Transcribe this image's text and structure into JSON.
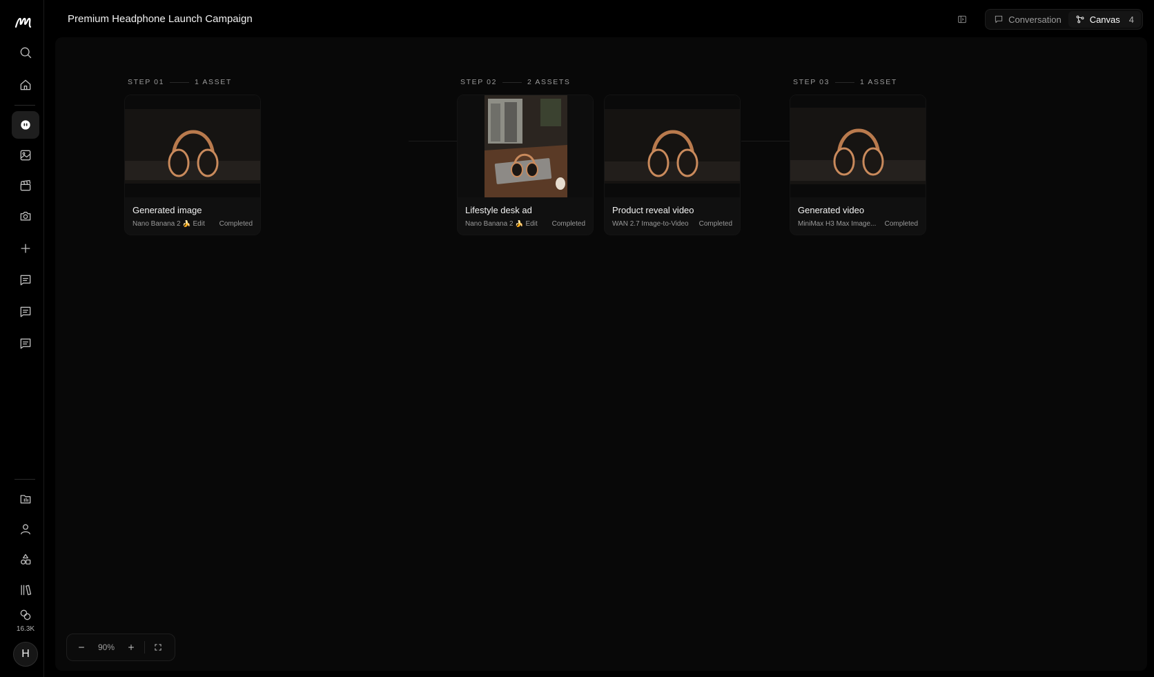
{
  "header": {
    "title": "Premium Headphone Launch Campaign",
    "tabs": [
      {
        "label": "Conversation",
        "active": false
      },
      {
        "label": "Canvas",
        "active": true,
        "count": "4"
      }
    ]
  },
  "sidebar": {
    "credits": "16.3K",
    "avatar_initial": "H"
  },
  "canvas": {
    "steps": [
      {
        "label": "STEP 01",
        "assets": "1 ASSET"
      },
      {
        "label": "STEP 02",
        "assets": "2 ASSETS"
      },
      {
        "label": "STEP 03",
        "assets": "1 ASSET"
      }
    ],
    "cards": [
      {
        "title": "Generated image",
        "model": "Nano Banana 2 🍌 Edit",
        "status": "Completed"
      },
      {
        "title": "Lifestyle desk ad",
        "model": "Nano Banana 2 🍌 Edit",
        "status": "Completed"
      },
      {
        "title": "Product reveal video",
        "model": "WAN 2.7 Image-to-Video",
        "status": "Completed"
      },
      {
        "title": "Generated video",
        "model": "MiniMax H3 Max Image...",
        "status": "Completed"
      }
    ]
  },
  "zoom": {
    "level": "90%"
  },
  "colors": {
    "background": "#000000",
    "canvas": "#080808",
    "card": "#101010",
    "accent_copper": "#c98a5c"
  }
}
